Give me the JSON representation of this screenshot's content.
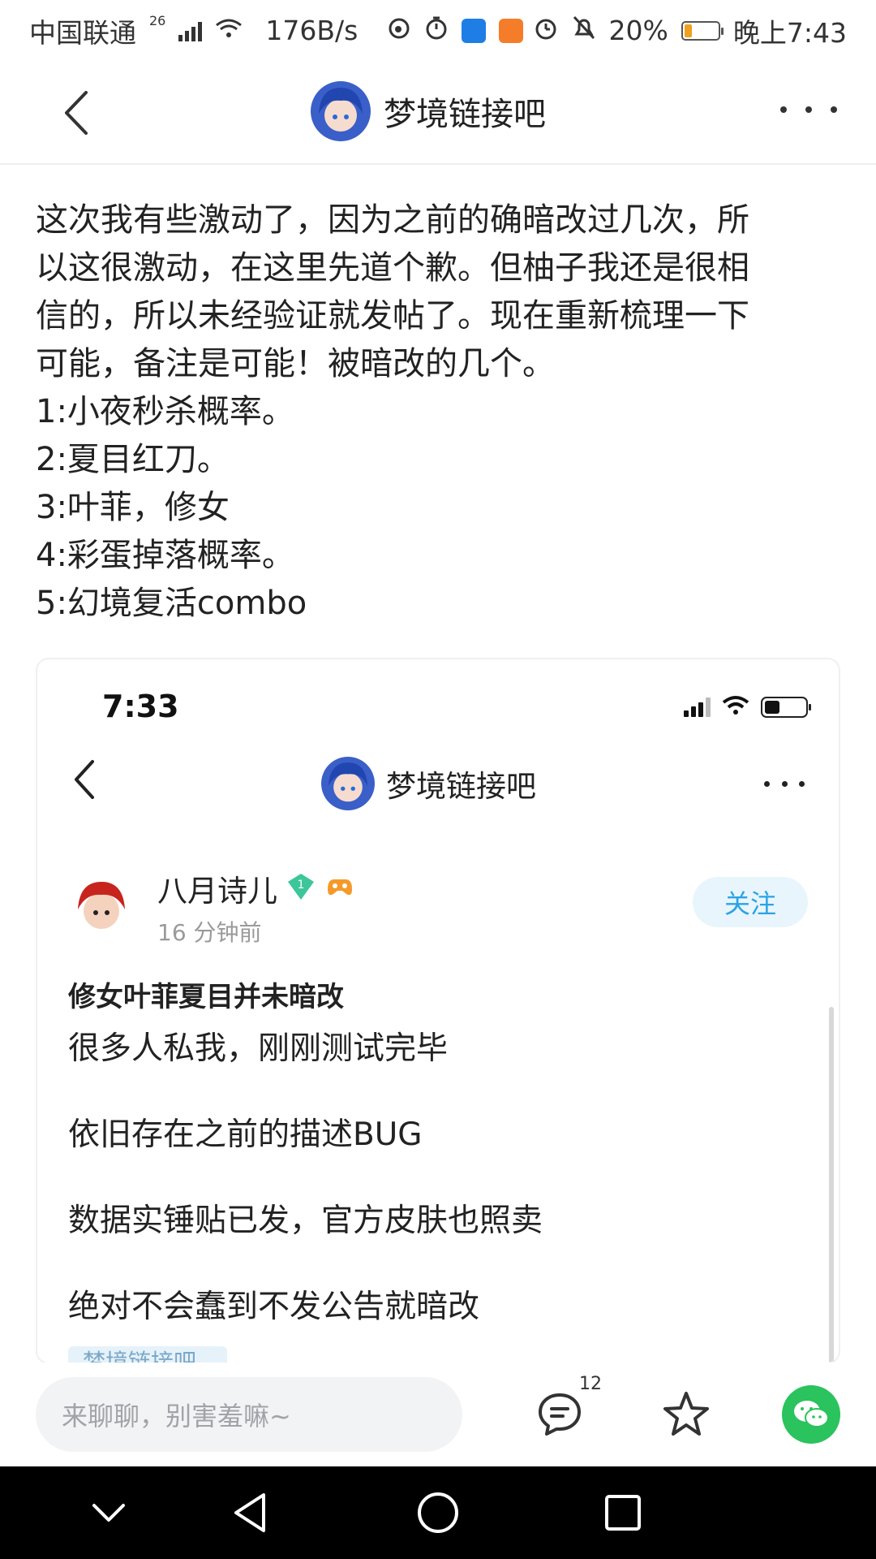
{
  "status_bar": {
    "carrier": "中国联通",
    "network_gen": "26",
    "speed": "176B/s",
    "battery": "20%",
    "battery_level": 0.2,
    "time": "晚上7:43",
    "icons": [
      "signal-icon",
      "wifi-icon",
      "weibo-icon",
      "timer-icon",
      "shield-app-icon",
      "uc-browser-icon",
      "alarm-icon",
      "mute-icon",
      "battery-icon"
    ]
  },
  "header": {
    "title": "梦境链接吧",
    "back_icon": "chevron-left-icon",
    "more_icon": "more-dots-icon"
  },
  "post": {
    "lines": [
      "这次我有些激动了，因为之前的确暗改过几次，所",
      "以这很激动，在这里先道个歉。但柚子我还是很相",
      "信的，所以未经验证就发帖了。现在重新梳理一下",
      "可能，备注是可能！被暗改的几个。",
      "1:小夜秒杀概率。",
      "2:夏目红刀。",
      "3:叶菲，修女",
      "4:彩蛋掉落概率。",
      "5:幻境复活combo"
    ]
  },
  "screenshot": {
    "time": "7:33",
    "forum_title": "梦境链接吧",
    "user_name": "八月诗儿",
    "post_time": "16 分钟前",
    "follow_label": "关注",
    "post_title": "修女叶菲夏目并未暗改",
    "lines": [
      "很多人私我，刚刚测试完毕",
      "依旧存在之前的描述BUG",
      "数据实锤贴已发，官方皮肤也照卖",
      "绝对不会蠢到不发公告就暗改"
    ],
    "tag_peek": "梦境链接吧"
  },
  "bottom_bar": {
    "input_placeholder": "来聊聊，别害羞嘛~",
    "comment_count": "12",
    "icons": [
      "comment-icon",
      "star-icon",
      "wechat-icon"
    ],
    "wechat_color": "#2ac35d"
  },
  "nav_bar": {
    "icons": [
      "nav-collapse-icon",
      "nav-back-icon",
      "nav-home-icon",
      "nav-recents-icon"
    ]
  }
}
